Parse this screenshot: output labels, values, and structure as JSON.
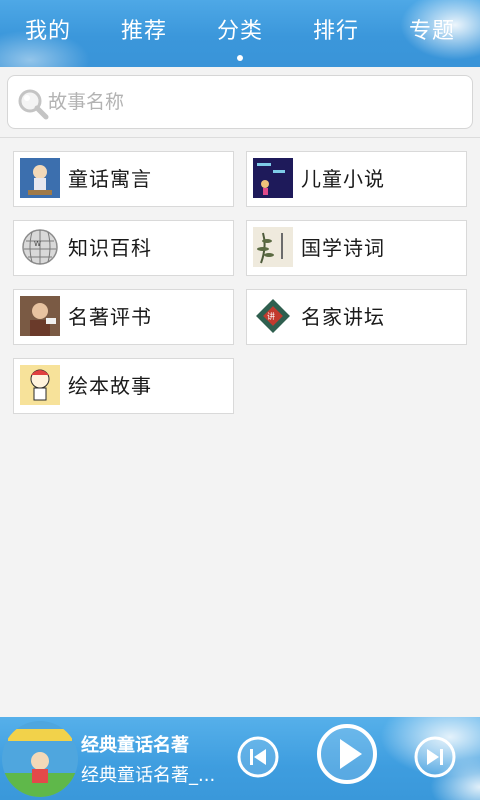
{
  "tabs": [
    {
      "label": "我的",
      "active": false
    },
    {
      "label": "推荐",
      "active": false
    },
    {
      "label": "分类",
      "active": true
    },
    {
      "label": "排行",
      "active": false
    },
    {
      "label": "专题",
      "active": false
    }
  ],
  "search": {
    "placeholder": "故事名称",
    "value": ""
  },
  "categories": [
    {
      "label": "童话寓言",
      "icon": "fairy-tale-thumb"
    },
    {
      "label": "儿童小说",
      "icon": "kids-novel-thumb"
    },
    {
      "label": "知识百科",
      "icon": "encyclopedia-globe-thumb"
    },
    {
      "label": "国学诗词",
      "icon": "poetry-thumb"
    },
    {
      "label": "名著评书",
      "icon": "storyteller-thumb"
    },
    {
      "label": "名家讲坛",
      "icon": "lecture-thumb"
    },
    {
      "label": "绘本故事",
      "icon": "picture-book-thumb"
    }
  ],
  "player": {
    "title": "经典童话名著",
    "subtitle": "经典童话名著_...",
    "cover_icon": "album-cover-thumb",
    "prev_icon": "previous-icon",
    "play_icon": "play-icon",
    "next_icon": "next-icon"
  },
  "colors": {
    "bar_blue": "#3b97db",
    "page_bg": "#f3f3f3"
  }
}
